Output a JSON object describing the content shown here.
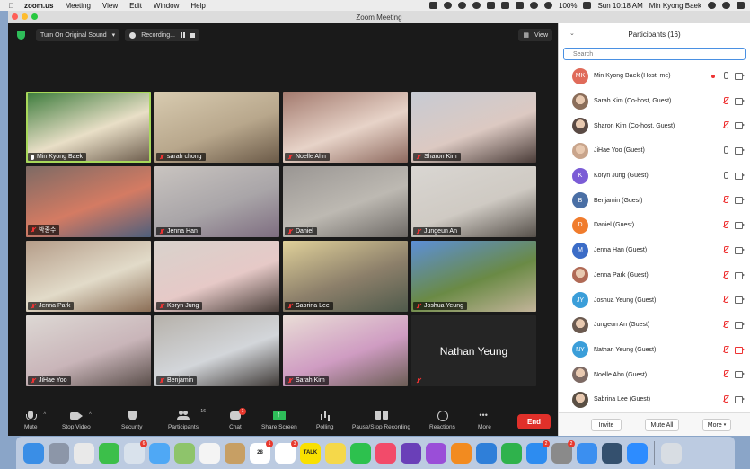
{
  "menubar": {
    "items": [
      "zoom.us",
      "Meeting",
      "View",
      "Edit",
      "Window",
      "Help"
    ],
    "battery": "100%",
    "clock": "Sun 10:18 AM",
    "user": "Min Kyong Baek"
  },
  "window": {
    "title": "Zoom Meeting"
  },
  "topbar": {
    "original_sound": "Turn On Original Sound",
    "recording": "Recording...",
    "view": "View"
  },
  "tiles": [
    {
      "name": "Min Kyong Baek",
      "mic": "on",
      "active": true,
      "bg": [
        "#3a7a3a",
        "#e9dfc7",
        "#6a5a4a"
      ]
    },
    {
      "name": "sarah chong",
      "mic": "off",
      "bg": [
        "#d8cbb0",
        "#b8a78c",
        "#6b5a48"
      ]
    },
    {
      "name": "Noelle Ahn",
      "mic": "off",
      "bg": [
        "#a37a6e",
        "#e7d3c8",
        "#8e6a5f"
      ]
    },
    {
      "name": "Sharon Kim",
      "mic": "off",
      "bg": [
        "#c7cbd3",
        "#dcc9c2",
        "#4a3c38"
      ]
    },
    {
      "name": "박종수",
      "mic": "off",
      "bg": [
        "#7d6a64",
        "#d47b63",
        "#4e5f7c"
      ]
    },
    {
      "name": "Jenna Han",
      "mic": "off",
      "bg": [
        "#c9c4c0",
        "#a9a5a8",
        "#7e6d80"
      ]
    },
    {
      "name": "Daniel",
      "mic": "off",
      "bg": [
        "#9a9693",
        "#bdb9b2",
        "#6e6a66"
      ]
    },
    {
      "name": "Jungeun An",
      "mic": "off",
      "bg": [
        "#d9d6d2",
        "#cfcac3",
        "#56504a"
      ]
    },
    {
      "name": "Jenna Park",
      "mic": "off",
      "bg": [
        "#b59d89",
        "#e2dbc9",
        "#8b6e56"
      ]
    },
    {
      "name": "Koryn Jung",
      "mic": "off",
      "bg": [
        "#d8d2cc",
        "#e6c9c7",
        "#4a3f3a"
      ]
    },
    {
      "name": "Sabrina Lee",
      "mic": "off",
      "bg": [
        "#e0d19a",
        "#8c7f6a",
        "#4f5a4b"
      ]
    },
    {
      "name": "Joshua Yeung",
      "mic": "off",
      "bg": [
        "#5c8fd8",
        "#6a8a45",
        "#c3b49a"
      ]
    },
    {
      "name": "JiHae Yoo",
      "mic": "off",
      "bg": [
        "#ddd8d4",
        "#c9b5b9",
        "#5a4e4a"
      ]
    },
    {
      "name": "Benjamin",
      "mic": "off",
      "bg": [
        "#b6b1aa",
        "#d3d6da",
        "#3f3a37"
      ]
    },
    {
      "name": "Sarah Kim",
      "mic": "off",
      "bg": [
        "#e9ddd6",
        "#cf9cc2",
        "#6b5d55"
      ]
    },
    {
      "name": "",
      "mic": "off",
      "placeholder": "Nathan Yeung",
      "bg": [
        "#252525",
        "#252525",
        "#252525"
      ]
    }
  ],
  "toolbar": {
    "mute": "Mute",
    "stop_video": "Stop Video",
    "security": "Security",
    "participants": "Participants",
    "participants_count": "16",
    "chat": "Chat",
    "chat_badge": "1",
    "share_screen": "Share Screen",
    "polling": "Polling",
    "pause_stop_recording": "Pause/Stop Recording",
    "reactions": "Reactions",
    "more": "More",
    "end": "End"
  },
  "panel": {
    "title": "Participants (16)",
    "search_placeholder": "Search",
    "participants": [
      {
        "name": "Min Kyong Baek (Host, me)",
        "initials": "MK",
        "avatar_color": "#e06b5a",
        "photo": false,
        "mic": "on",
        "cam": "on",
        "rec": true
      },
      {
        "name": "Sarah Kim (Co-host, Guest)",
        "initials": "",
        "avatar_color": "#8b6e5a",
        "photo": true,
        "mic": "off",
        "cam": "on"
      },
      {
        "name": "Sharon Kim (Co-host, Guest)",
        "initials": "",
        "avatar_color": "#5a4a44",
        "photo": true,
        "mic": "off",
        "cam": "on"
      },
      {
        "name": "JiHae Yoo (Guest)",
        "initials": "",
        "avatar_color": "#c9a58c",
        "photo": true,
        "mic": "on",
        "cam": "on"
      },
      {
        "name": "Koryn Jung (Guest)",
        "initials": "K",
        "avatar_color": "#7b5cd6",
        "photo": false,
        "mic": "on",
        "cam": "on"
      },
      {
        "name": "Benjamin (Guest)",
        "initials": "B",
        "avatar_color": "#4a6fa5",
        "photo": false,
        "mic": "off",
        "cam": "on"
      },
      {
        "name": "Daniel (Guest)",
        "initials": "D",
        "avatar_color": "#f07c2d",
        "photo": false,
        "mic": "off",
        "cam": "on"
      },
      {
        "name": "Jenna Han (Guest)",
        "initials": "M",
        "avatar_color": "#3b6cc7",
        "photo": false,
        "mic": "off",
        "cam": "on"
      },
      {
        "name": "Jenna Park (Guest)",
        "initials": "",
        "avatar_color": "#b06a56",
        "photo": true,
        "mic": "off",
        "cam": "on"
      },
      {
        "name": "Joshua Yeung (Guest)",
        "initials": "JY",
        "avatar_color": "#3b9ed9",
        "photo": false,
        "mic": "off",
        "cam": "on"
      },
      {
        "name": "Jungeun An (Guest)",
        "initials": "",
        "avatar_color": "#6b5a50",
        "photo": true,
        "mic": "off",
        "cam": "on"
      },
      {
        "name": "Nathan Yeung (Guest)",
        "initials": "NY",
        "avatar_color": "#3b9ed9",
        "photo": false,
        "mic": "off",
        "cam": "off"
      },
      {
        "name": "Noelle Ahn (Guest)",
        "initials": "",
        "avatar_color": "#7d6a64",
        "photo": true,
        "mic": "off",
        "cam": "on"
      },
      {
        "name": "Sabrina Lee (Guest)",
        "initials": "",
        "avatar_color": "#5a4f44",
        "photo": true,
        "mic": "off",
        "cam": "on"
      }
    ],
    "invite": "Invite",
    "mute_all": "Mute All",
    "more": "More"
  },
  "dock": {
    "apps": [
      {
        "name": "finder-icon",
        "color": "#3a8ee6"
      },
      {
        "name": "launchpad-icon",
        "color": "#8c96a8"
      },
      {
        "name": "chrome-icon",
        "color": "#e9e9e9"
      },
      {
        "name": "facetime-icon",
        "color": "#3cbf4a"
      },
      {
        "name": "preview-icon",
        "color": "#d9e2ec",
        "badge": "6"
      },
      {
        "name": "messages-icon",
        "color": "#4fa8f5"
      },
      {
        "name": "maps-icon",
        "color": "#8ec46b"
      },
      {
        "name": "photos-icon",
        "color": "#f4f4f4"
      },
      {
        "name": "notes-folder-icon",
        "color": "#c79f64"
      },
      {
        "name": "calendar-icon",
        "color": "#ffffff",
        "label": "28",
        "badge": "1"
      },
      {
        "name": "reminders-icon",
        "color": "#ffffff",
        "badge": "3"
      },
      {
        "name": "kakaotalk-icon",
        "color": "#f9e000",
        "label": "TALK"
      },
      {
        "name": "notes-icon",
        "color": "#f5d84a"
      },
      {
        "name": "line-icon",
        "color": "#2dc14e"
      },
      {
        "name": "music-icon",
        "color": "#f24b6a"
      },
      {
        "name": "imovie-icon",
        "color": "#6a3fb8"
      },
      {
        "name": "podcasts-icon",
        "color": "#9a4ed8"
      },
      {
        "name": "books-icon",
        "color": "#f28b20"
      },
      {
        "name": "keynote-icon",
        "color": "#2f7fd9"
      },
      {
        "name": "evernote-icon",
        "color": "#2fb24c"
      },
      {
        "name": "app-store-icon",
        "color": "#2d8cf0",
        "badge": "2"
      },
      {
        "name": "system-preferences-icon",
        "color": "#8a8a8a",
        "badge": "2"
      },
      {
        "name": "safari-icon",
        "color": "#3b8ff0"
      },
      {
        "name": "quicktime-icon",
        "color": "#34506e"
      },
      {
        "name": "zoom-icon",
        "color": "#2d8cff"
      },
      {
        "name": "trash-icon",
        "color": "#d8dde3"
      }
    ]
  }
}
